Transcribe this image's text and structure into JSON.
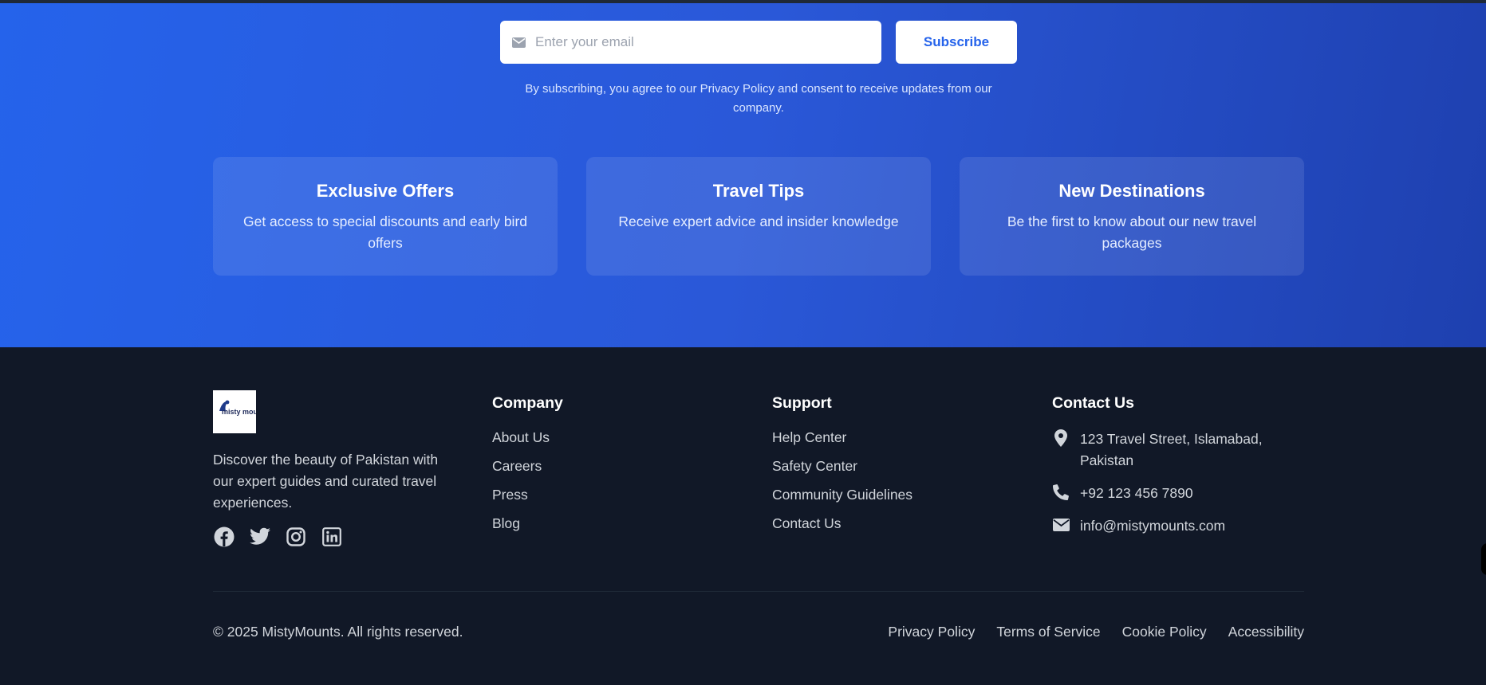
{
  "newsletter": {
    "email_placeholder": "Enter your email",
    "subscribe_label": "Subscribe",
    "disclaimer": "By subscribing, you agree to our Privacy Policy and consent to receive updates from our company.",
    "features": [
      {
        "title": "Exclusive Offers",
        "text": "Get access to special discounts and early bird offers"
      },
      {
        "title": "Travel Tips",
        "text": "Receive expert advice and insider knowledge"
      },
      {
        "title": "New Destinations",
        "text": "Be the first to know about our new travel packages"
      }
    ]
  },
  "footer": {
    "logo_text": "misty mountain",
    "brand_description": "Discover the beauty of Pakistan with our expert guides and curated travel experiences.",
    "socials": [
      "facebook-icon",
      "twitter-icon",
      "instagram-icon",
      "linkedin-icon"
    ],
    "company": {
      "heading": "Company",
      "links": [
        "About Us",
        "Careers",
        "Press",
        "Blog"
      ]
    },
    "support": {
      "heading": "Support",
      "links": [
        "Help Center",
        "Safety Center",
        "Community Guidelines",
        "Contact Us"
      ]
    },
    "contact": {
      "heading": "Contact Us",
      "address": "123 Travel Street, Islamabad, Pakistan",
      "phone": "+92 123 456 7890",
      "email": "info@mistymounts.com"
    },
    "copyright": "© 2025 MistyMounts. All rights reserved.",
    "legal_links": [
      "Privacy Policy",
      "Terms of Service",
      "Cookie Policy",
      "Accessibility"
    ]
  },
  "colors": {
    "accent": "#2563eb",
    "footer_bg": "#111827",
    "footer_text": "#d1d5db"
  }
}
